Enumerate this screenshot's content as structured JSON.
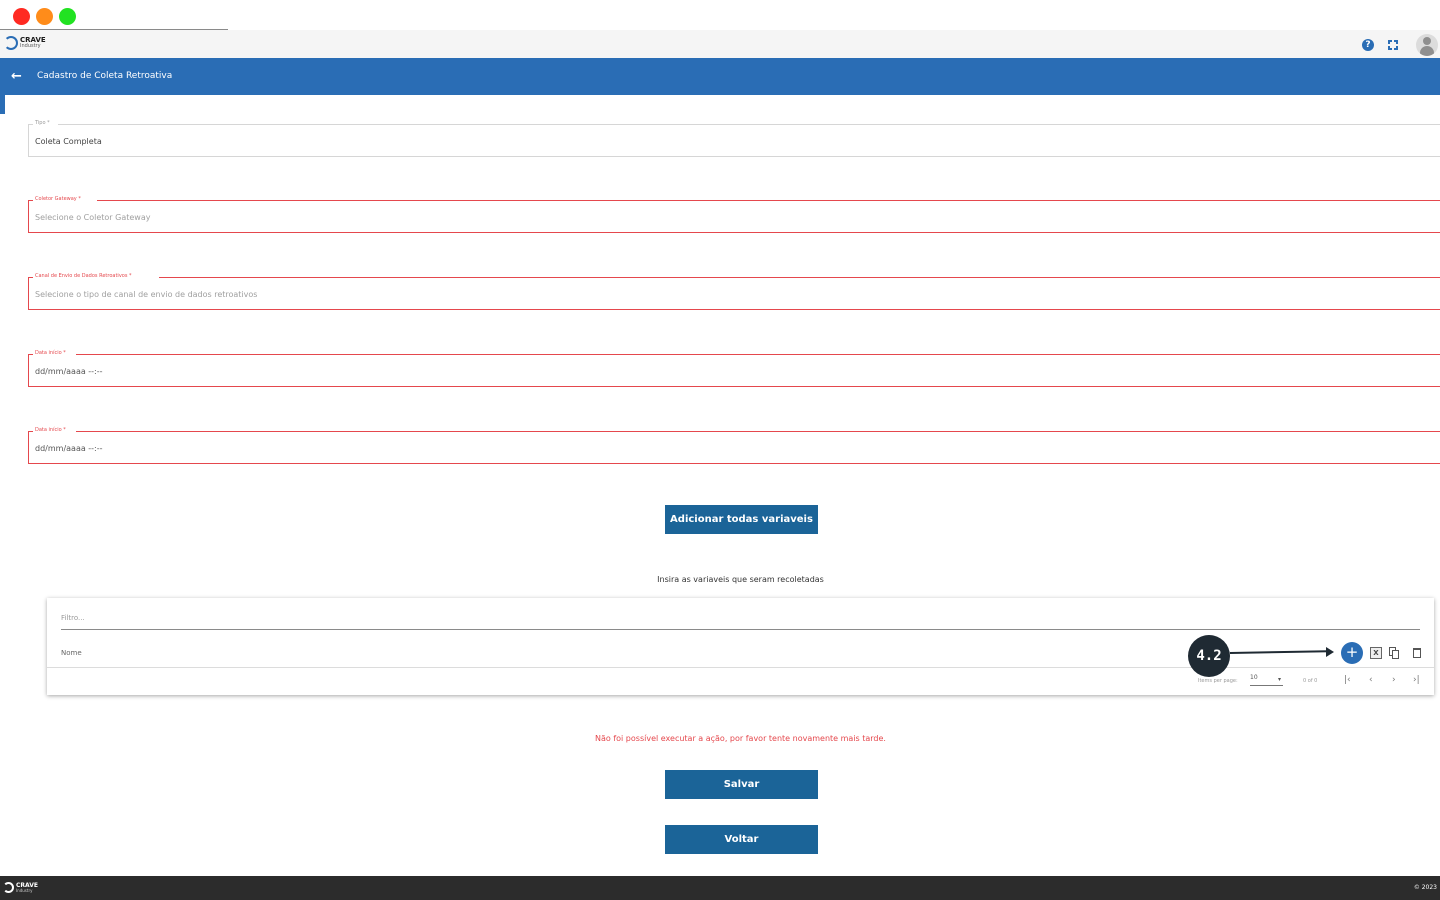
{
  "window": {
    "dots": [
      "#ff2a22",
      "#ff8c1a",
      "#22e222"
    ]
  },
  "brand": {
    "name": "CRAVE",
    "sub": "Industry"
  },
  "header": {
    "title": "Cadastro de Coleta Retroativa",
    "back_icon": "arrow-left-icon"
  },
  "form": {
    "tipo": {
      "label": "Tipo *",
      "value": "Coleta Completa"
    },
    "coletor": {
      "label": "Coletor Gateway *",
      "placeholder": "Selecione o Coletor Gateway"
    },
    "canal": {
      "label": "Canal de Envio de Dados Retroativos *",
      "placeholder": "Selecione o tipo de canal de envio de dados retroativos"
    },
    "data_inicio_1": {
      "label": "Data início *",
      "value": "dd/mm/aaaa --:--"
    },
    "data_inicio_2": {
      "label": "Data início *",
      "value": "dd/mm/aaaa --:--"
    }
  },
  "buttons": {
    "add_all": "Adicionar todas variaveis",
    "save": "Salvar",
    "back": "Voltar"
  },
  "variables": {
    "instruction": "Insira as variaveis que seram recoletadas",
    "filter_placeholder": "Filtro...",
    "column_name": "Nome",
    "add_icon": "plus-icon",
    "excel_icon": "excel-icon",
    "copy_icon": "copy-icon",
    "delete_icon": "trash-icon",
    "pagination": {
      "items_per_page_label": "Items per page:",
      "items_per_page": "10",
      "range": "0 of 0"
    }
  },
  "annotation": {
    "label": "4.2"
  },
  "error_message": "Não foi possível executar a ação, por favor tente novamente mais tarde.",
  "footer": {
    "copyright": "© 2023"
  },
  "colors": {
    "primary": "#2a6db5",
    "button": "#1b6498",
    "error": "#e5484d",
    "footer": "#2c2c2c"
  }
}
